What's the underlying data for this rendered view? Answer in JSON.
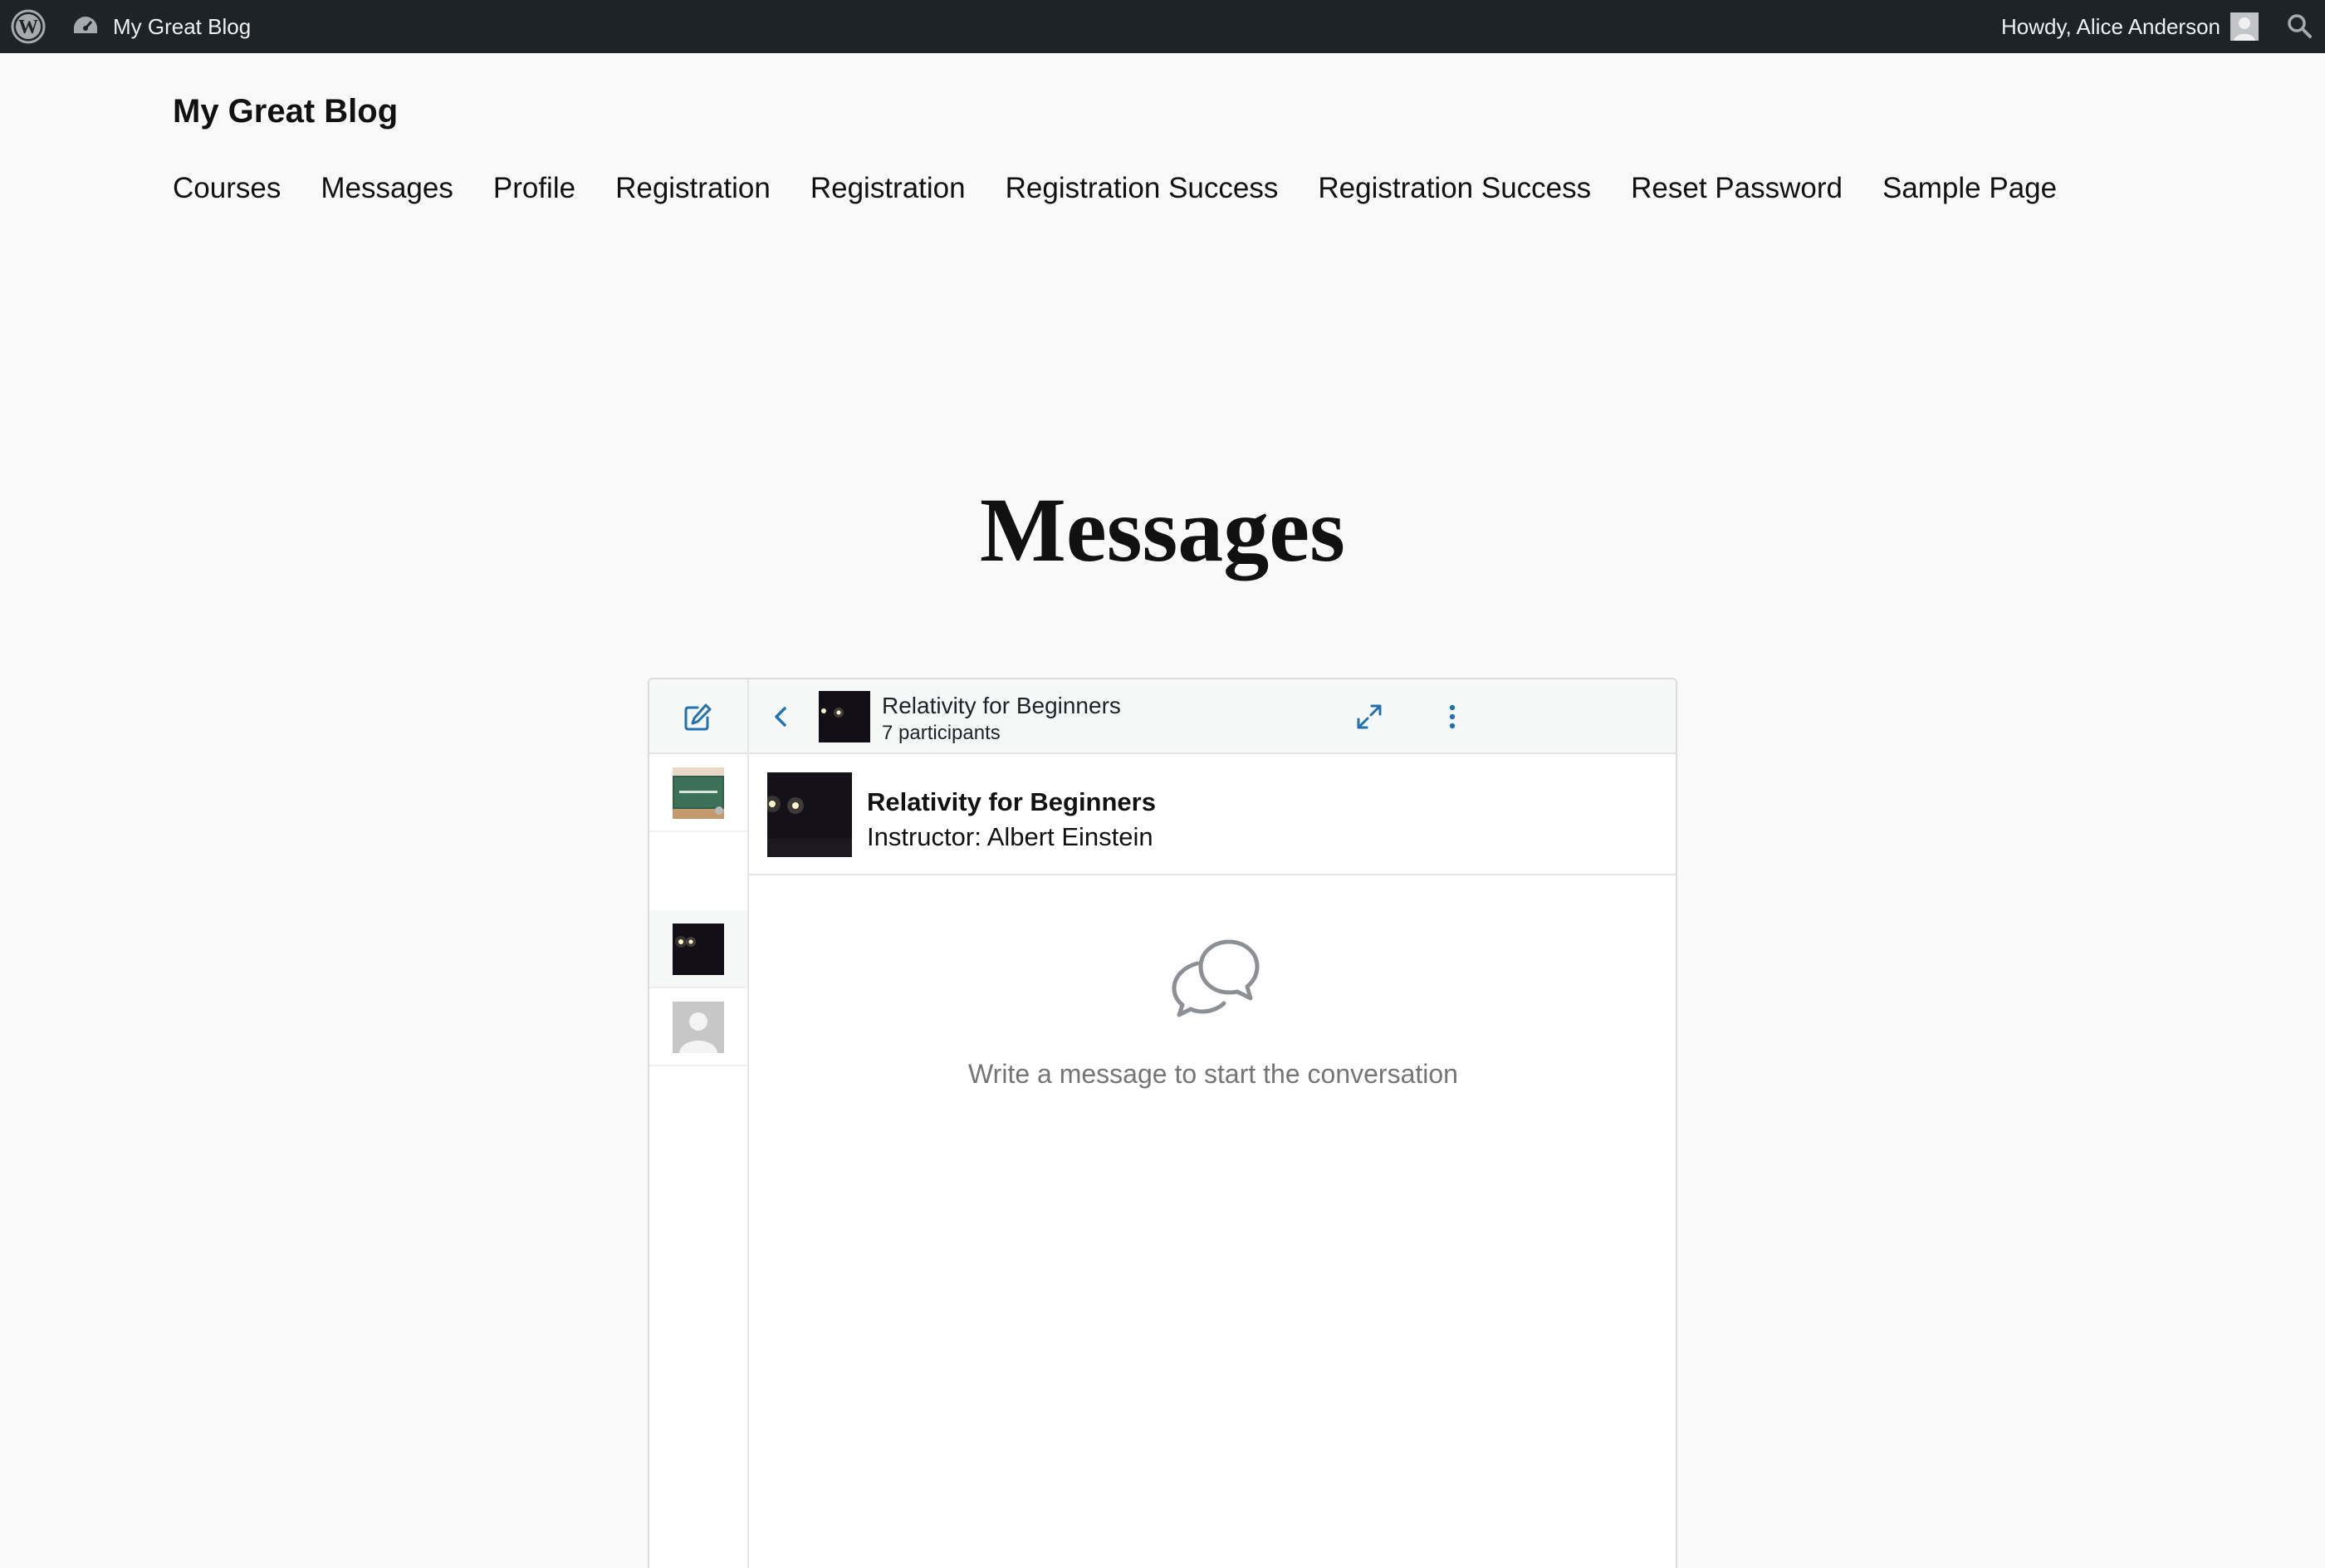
{
  "admin_bar": {
    "site_name": "My Great Blog",
    "howdy": "Howdy, Alice Anderson"
  },
  "site": {
    "title": "My Great Blog",
    "nav": [
      "Courses",
      "Messages",
      "Profile",
      "Registration",
      "Registration",
      "Registration Success",
      "Registration Success",
      "Reset Password",
      "Sample Page"
    ]
  },
  "page": {
    "title": "Messages"
  },
  "messages": {
    "conversation_title": "Relativity for Beginners",
    "participants": "7 participants",
    "course_name": "Relativity for Beginners",
    "instructor": "Instructor: Albert Einstein",
    "empty_text": "Write a message to start the conversation"
  },
  "colors": {
    "admin_bar_bg": "#1d2327",
    "accent": "#2271b1",
    "page_bg": "#f9f9f9"
  },
  "icons": [
    "wordpress-logo-icon",
    "dashboard-icon",
    "search-icon",
    "compose-icon",
    "back-arrow-icon",
    "expand-icon",
    "more-vertical-icon",
    "chat-bubbles-icon"
  ]
}
